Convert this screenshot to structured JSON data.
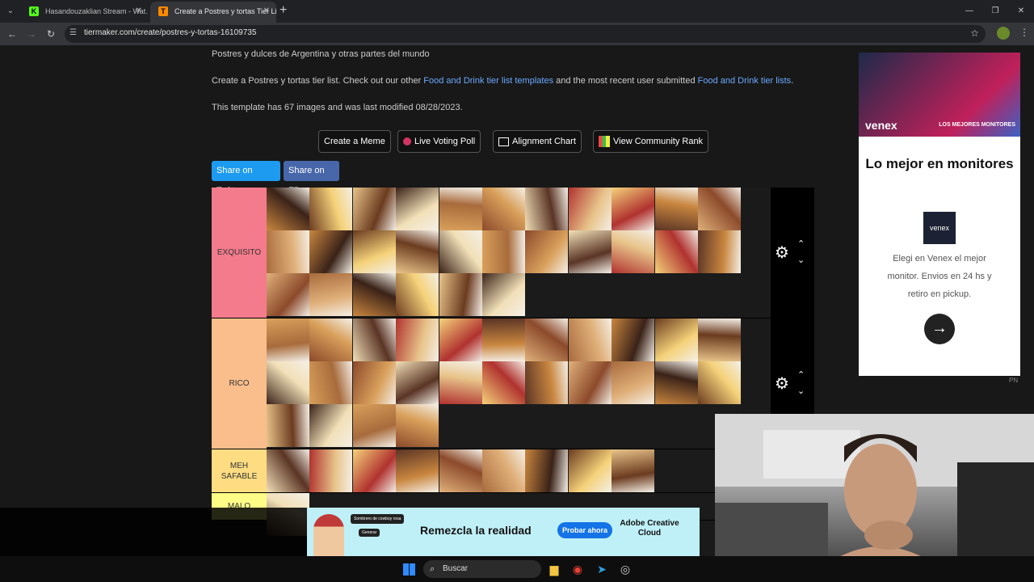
{
  "browser": {
    "tabs": [
      {
        "label": "Hasandouzaklian Stream - Wat…",
        "favicon": "K",
        "favicon_color": "#53fc18",
        "active": false
      },
      {
        "label": "Create a Postres y tortas Tier Li…",
        "favicon": "T",
        "favicon_color": "#ff8a00",
        "active": true
      }
    ],
    "new_tab": "+",
    "url": "tiermaker.com/create/postres-y-tortas-16109735"
  },
  "page": {
    "subtitle": "Postres y dulces de Argentina y otras partes del mundo",
    "intro_before": "Create a Postres y tortas tier list. Check out our other ",
    "intro_link1": "Food and Drink tier list templates",
    "intro_mid": " and the most recent user submitted ",
    "intro_link2": "Food and Drink tier lists",
    "intro_end": ".",
    "template_info": "This template has 67 images and was last modified 08/28/2023.",
    "buttons": {
      "meme": "Create a Meme",
      "voting": "Live Voting Poll",
      "alignment": "Alignment Chart",
      "community": "View Community Rank"
    },
    "share_twitter": "Share on Twitter",
    "share_fb": "Share on FB"
  },
  "tiers": [
    {
      "label": "EXQUISITO",
      "color": "#f47b8c",
      "rows": 3,
      "counts": [
        11,
        11,
        6
      ]
    },
    {
      "label": "RICO",
      "color": "#f9be8c",
      "rows": 3,
      "counts": [
        11,
        11,
        4
      ]
    },
    {
      "label": "MEH SAFABLE",
      "color": "#fddc82",
      "rows": 1,
      "counts": [
        9
      ]
    },
    {
      "label": "MALO",
      "color": "#fdfc86",
      "rows": 1,
      "counts": [
        1
      ]
    }
  ],
  "ad_side": {
    "brand": "venex",
    "tag": "LOS MEJORES MONITORES",
    "title": "Lo mejor en monitores",
    "logo": "venex",
    "text": "Elegi en Venex el mejor monitor. Envios en 24 hs y retiro en pickup.",
    "go": "→",
    "pn": "PN"
  },
  "ad_bottom": {
    "bubble": "Sombrero de cowboy rosa",
    "bubble2": "Generar",
    "text": "Remezcla la realidad",
    "button": "Probar ahora",
    "brand": "Adobe Creative Cloud"
  },
  "taskbar": {
    "search": "Buscar"
  }
}
